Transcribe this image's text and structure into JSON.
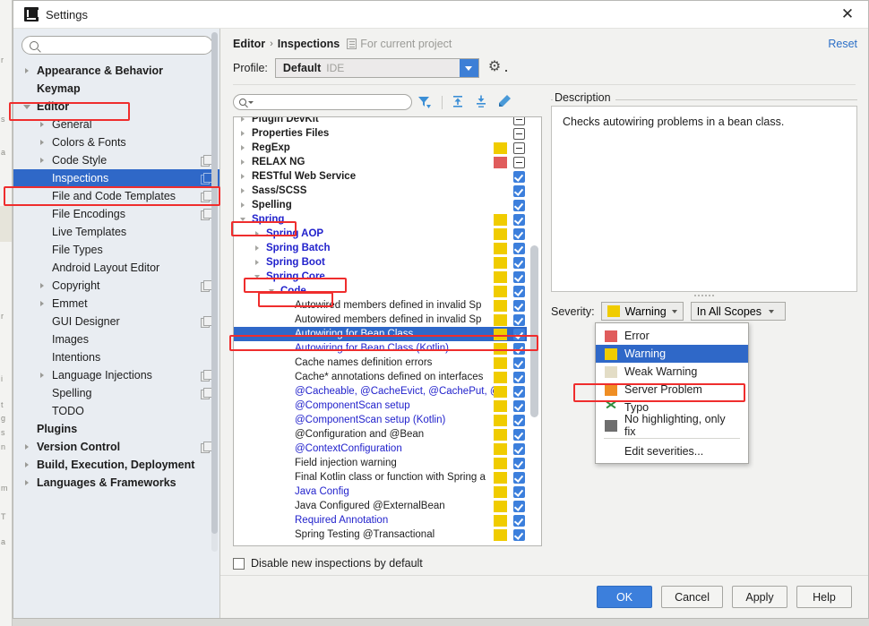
{
  "window": {
    "title": "Settings",
    "close_label": "✕",
    "logo_icon": "intellij-logo-icon"
  },
  "sidebar": {
    "search_placeholder": "",
    "search_value": "",
    "items": [
      {
        "label": "Appearance & Behavior",
        "indent": 0,
        "arrow": "right",
        "bold": true,
        "copy": false,
        "selected": false
      },
      {
        "label": "Keymap",
        "indent": 0,
        "arrow": "none",
        "bold": true,
        "copy": false,
        "selected": false
      },
      {
        "label": "Editor",
        "indent": 0,
        "arrow": "down",
        "bold": true,
        "copy": false,
        "selected": false
      },
      {
        "label": "General",
        "indent": 1,
        "arrow": "right",
        "bold": false,
        "copy": false,
        "selected": false
      },
      {
        "label": "Colors & Fonts",
        "indent": 1,
        "arrow": "right",
        "bold": false,
        "copy": false,
        "selected": false
      },
      {
        "label": "Code Style",
        "indent": 1,
        "arrow": "right",
        "bold": false,
        "copy": true,
        "selected": false
      },
      {
        "label": "Inspections",
        "indent": 1,
        "arrow": "none",
        "bold": false,
        "copy": true,
        "selected": true
      },
      {
        "label": "File and Code Templates",
        "indent": 1,
        "arrow": "none",
        "bold": false,
        "copy": true,
        "selected": false
      },
      {
        "label": "File Encodings",
        "indent": 1,
        "arrow": "none",
        "bold": false,
        "copy": true,
        "selected": false
      },
      {
        "label": "Live Templates",
        "indent": 1,
        "arrow": "none",
        "bold": false,
        "copy": false,
        "selected": false
      },
      {
        "label": "File Types",
        "indent": 1,
        "arrow": "none",
        "bold": false,
        "copy": false,
        "selected": false
      },
      {
        "label": "Android Layout Editor",
        "indent": 1,
        "arrow": "none",
        "bold": false,
        "copy": false,
        "selected": false
      },
      {
        "label": "Copyright",
        "indent": 1,
        "arrow": "right",
        "bold": false,
        "copy": true,
        "selected": false
      },
      {
        "label": "Emmet",
        "indent": 1,
        "arrow": "right",
        "bold": false,
        "copy": false,
        "selected": false
      },
      {
        "label": "GUI Designer",
        "indent": 1,
        "arrow": "none",
        "bold": false,
        "copy": true,
        "selected": false
      },
      {
        "label": "Images",
        "indent": 1,
        "arrow": "none",
        "bold": false,
        "copy": false,
        "selected": false
      },
      {
        "label": "Intentions",
        "indent": 1,
        "arrow": "none",
        "bold": false,
        "copy": false,
        "selected": false
      },
      {
        "label": "Language Injections",
        "indent": 1,
        "arrow": "right",
        "bold": false,
        "copy": true,
        "selected": false
      },
      {
        "label": "Spelling",
        "indent": 1,
        "arrow": "none",
        "bold": false,
        "copy": true,
        "selected": false
      },
      {
        "label": "TODO",
        "indent": 1,
        "arrow": "none",
        "bold": false,
        "copy": false,
        "selected": false
      },
      {
        "label": "Plugins",
        "indent": 0,
        "arrow": "none",
        "bold": true,
        "copy": false,
        "selected": false
      },
      {
        "label": "Version Control",
        "indent": 0,
        "arrow": "right",
        "bold": true,
        "copy": true,
        "selected": false
      },
      {
        "label": "Build, Execution, Deployment",
        "indent": 0,
        "arrow": "right",
        "bold": true,
        "copy": false,
        "selected": false
      },
      {
        "label": "Languages & Frameworks",
        "indent": 0,
        "arrow": "right",
        "bold": true,
        "copy": false,
        "selected": false
      }
    ]
  },
  "header": {
    "breadcrumb_root": "Editor",
    "breadcrumb_sep": "›",
    "breadcrumb_leaf": "Inspections",
    "scope_note": "For current project",
    "reset_label": "Reset",
    "profile_label": "Profile:",
    "profile_value": "Default",
    "profile_suffix": "IDE"
  },
  "inspections": {
    "search_placeholder": "",
    "search_value": "",
    "toolbar_icons": [
      "filter-icon",
      "expand-all-icon",
      "collapse-all-icon",
      "reset-to-defaults-icon"
    ],
    "disable_new_label": "Disable new inspections by default",
    "disable_new_checked": false,
    "rows": [
      {
        "label": "Plugin DevKit",
        "indent": 0,
        "arrow": "right",
        "style": "bold",
        "chip": "none",
        "check": "partial",
        "selected": false,
        "clipped": true
      },
      {
        "label": "Properties Files",
        "indent": 0,
        "arrow": "right",
        "style": "bold",
        "chip": "none",
        "check": "partial",
        "selected": false
      },
      {
        "label": "RegExp",
        "indent": 0,
        "arrow": "right",
        "style": "bold",
        "chip": "warning",
        "check": "partial",
        "selected": false
      },
      {
        "label": "RELAX NG",
        "indent": 0,
        "arrow": "right",
        "style": "bold",
        "chip": "error",
        "check": "partial",
        "selected": false
      },
      {
        "label": "RESTful Web Service",
        "indent": 0,
        "arrow": "right",
        "style": "bold",
        "chip": "none",
        "check": "on",
        "selected": false
      },
      {
        "label": "Sass/SCSS",
        "indent": 0,
        "arrow": "right",
        "style": "bold",
        "chip": "none",
        "check": "on",
        "selected": false
      },
      {
        "label": "Spelling",
        "indent": 0,
        "arrow": "right",
        "style": "bold",
        "chip": "none",
        "check": "on",
        "selected": false
      },
      {
        "label": "Spring",
        "indent": 0,
        "arrow": "down",
        "style": "bold-blue",
        "chip": "warning",
        "check": "on",
        "selected": false
      },
      {
        "label": "Spring AOP",
        "indent": 1,
        "arrow": "right",
        "style": "bold-blue",
        "chip": "warning",
        "check": "on",
        "selected": false
      },
      {
        "label": "Spring Batch",
        "indent": 1,
        "arrow": "right",
        "style": "bold-blue",
        "chip": "warning",
        "check": "on",
        "selected": false
      },
      {
        "label": "Spring Boot",
        "indent": 1,
        "arrow": "right",
        "style": "bold-blue",
        "chip": "warning",
        "check": "on",
        "selected": false
      },
      {
        "label": "Spring Core",
        "indent": 1,
        "arrow": "down",
        "style": "bold-blue",
        "chip": "warning",
        "check": "on",
        "selected": false
      },
      {
        "label": "Code",
        "indent": 2,
        "arrow": "down",
        "style": "bold-blue",
        "chip": "warning",
        "check": "on",
        "selected": false
      },
      {
        "label": "Autowired members defined in invalid Sp",
        "indent": 3,
        "arrow": "none",
        "style": "plain",
        "chip": "warning",
        "check": "on",
        "selected": false
      },
      {
        "label": "Autowired members defined in invalid Sp",
        "indent": 3,
        "arrow": "none",
        "style": "plain",
        "chip": "warning",
        "check": "on",
        "selected": false
      },
      {
        "label": "Autowiring for Bean Class",
        "indent": 3,
        "arrow": "none",
        "style": "plain",
        "chip": "warning",
        "check": "on",
        "selected": true
      },
      {
        "label": "Autowiring for Bean Class (Kotlin)",
        "indent": 3,
        "arrow": "none",
        "style": "blue",
        "chip": "warning",
        "check": "on",
        "selected": false
      },
      {
        "label": "Cache names definition errors",
        "indent": 3,
        "arrow": "none",
        "style": "plain",
        "chip": "warning",
        "check": "on",
        "selected": false
      },
      {
        "label": "Cache* annotations defined on interfaces",
        "indent": 3,
        "arrow": "none",
        "style": "plain",
        "chip": "warning",
        "check": "on",
        "selected": false
      },
      {
        "label": "@Cacheable, @CacheEvict, @CachePut, @",
        "indent": 3,
        "arrow": "none",
        "style": "blue",
        "chip": "warning",
        "check": "on",
        "selected": false
      },
      {
        "label": "@ComponentScan setup",
        "indent": 3,
        "arrow": "none",
        "style": "blue",
        "chip": "warning",
        "check": "on",
        "selected": false
      },
      {
        "label": "@ComponentScan setup (Kotlin)",
        "indent": 3,
        "arrow": "none",
        "style": "blue",
        "chip": "warning",
        "check": "on",
        "selected": false
      },
      {
        "label": "@Configuration and @Bean",
        "indent": 3,
        "arrow": "none",
        "style": "plain",
        "chip": "warning",
        "check": "on",
        "selected": false
      },
      {
        "label": "@ContextConfiguration",
        "indent": 3,
        "arrow": "none",
        "style": "blue",
        "chip": "warning",
        "check": "on",
        "selected": false
      },
      {
        "label": "Field injection warning",
        "indent": 3,
        "arrow": "none",
        "style": "plain",
        "chip": "warning",
        "check": "on",
        "selected": false
      },
      {
        "label": "Final Kotlin class or function with Spring a",
        "indent": 3,
        "arrow": "none",
        "style": "plain",
        "chip": "warning",
        "check": "on",
        "selected": false
      },
      {
        "label": "Java Config",
        "indent": 3,
        "arrow": "none",
        "style": "blue",
        "chip": "warning",
        "check": "on",
        "selected": false
      },
      {
        "label": "Java Configured @ExternalBean",
        "indent": 3,
        "arrow": "none",
        "style": "plain",
        "chip": "warning",
        "check": "on",
        "selected": false
      },
      {
        "label": "Required Annotation",
        "indent": 3,
        "arrow": "none",
        "style": "blue",
        "chip": "warning",
        "check": "on",
        "selected": false
      },
      {
        "label": "Spring Testing @Transactional",
        "indent": 3,
        "arrow": "none",
        "style": "plain",
        "chip": "warning",
        "check": "on",
        "selected": false,
        "clipped": true
      }
    ]
  },
  "description": {
    "legend": "Description",
    "text": "Checks autowiring problems in a bean class."
  },
  "severity": {
    "label": "Severity:",
    "selected": "Warning",
    "scope_value": "In All Scopes",
    "popup_items": [
      {
        "label": "Error",
        "swatch": "#e05c5c",
        "kind": "swatch",
        "active": false
      },
      {
        "label": "Warning",
        "swatch": "#f0cc00",
        "kind": "swatch",
        "active": true
      },
      {
        "label": "Weak Warning",
        "swatch": "#e3ddc6",
        "kind": "swatch",
        "active": false
      },
      {
        "label": "Server Problem",
        "swatch": "#ef8e24",
        "kind": "swatch",
        "active": false
      },
      {
        "label": "Typo",
        "swatch": "",
        "kind": "typo",
        "active": false
      },
      {
        "label": "No highlighting, only fix",
        "swatch": "#6e6e6e",
        "kind": "swatch",
        "active": false
      }
    ],
    "edit_label": "Edit severities..."
  },
  "footer": {
    "ok": "OK",
    "cancel": "Cancel",
    "apply": "Apply",
    "help": "Help"
  },
  "colors": {
    "accent_blue": "#3c7fdc",
    "selection_blue": "#2f68c8",
    "warning_yellow": "#f0cc00",
    "error_red": "#e05c5c",
    "link_blue": "#2b6fc7",
    "annotation_red": "#ef2d2d",
    "tree_blue_text": "#2222cc"
  }
}
